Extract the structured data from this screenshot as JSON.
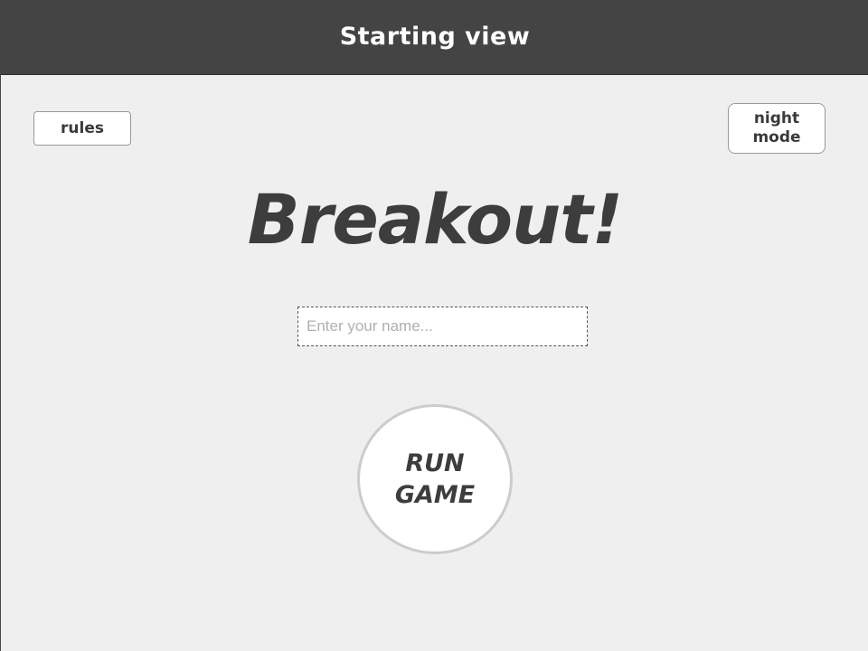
{
  "header": {
    "title": "Starting view"
  },
  "rules_button": {
    "label": "rules"
  },
  "night_mode_button": {
    "label_line1": "night",
    "label_line2": "mode"
  },
  "game": {
    "title": "Breakout!"
  },
  "name_input": {
    "value": "",
    "placeholder": "Enter your name..."
  },
  "run_button": {
    "label_line1": "RUN",
    "label_line2": "GAME"
  },
  "colors": {
    "header_bg": "#444444",
    "page_bg": "#efefef",
    "text_dark": "#3d3d3d",
    "button_border": "#cccccc"
  }
}
